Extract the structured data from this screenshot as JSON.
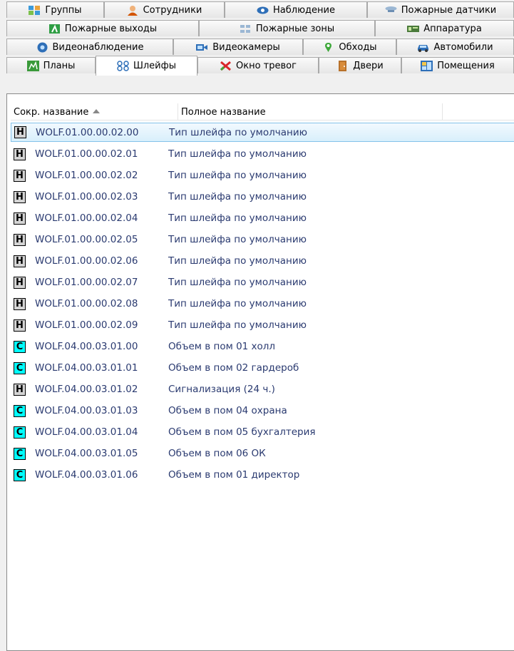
{
  "tabs": {
    "row1": [
      {
        "label": "Группы",
        "icon": "groups-icon"
      },
      {
        "label": "Сотрудники",
        "icon": "employee-icon"
      },
      {
        "label": "Наблюдение",
        "icon": "eye-icon"
      },
      {
        "label": "Пожарные датчики",
        "icon": "fire-sensor-icon"
      }
    ],
    "row2": [
      {
        "label": "Пожарные выходы",
        "icon": "fire-exit-icon"
      },
      {
        "label": "Пожарные зоны",
        "icon": "fire-zones-icon"
      },
      {
        "label": "Аппаратура",
        "icon": "hardware-icon"
      }
    ],
    "row3": [
      {
        "label": "Видеонаблюдение",
        "icon": "video-surveillance-icon"
      },
      {
        "label": "Видеокамеры",
        "icon": "video-camera-icon"
      },
      {
        "label": "Обходы",
        "icon": "patrol-icon"
      },
      {
        "label": "Автомобили",
        "icon": "car-icon"
      }
    ],
    "row4": [
      {
        "label": "Планы",
        "icon": "plans-icon"
      },
      {
        "label": "Шлейфы",
        "icon": "loops-icon",
        "active": true
      },
      {
        "label": "Окно тревог",
        "icon": "alarm-window-icon"
      },
      {
        "label": "Двери",
        "icon": "door-icon"
      },
      {
        "label": "Помещения",
        "icon": "rooms-icon"
      }
    ]
  },
  "list": {
    "columns": [
      "Сокр. название",
      "Полное название"
    ],
    "sorted_column": "Сокр. название",
    "rows": [
      {
        "badge": "H",
        "short": "WOLF.01.00.00.02.00",
        "full": "Тип шлейфа по умолчанию",
        "selected": true
      },
      {
        "badge": "H",
        "short": "WOLF.01.00.00.02.01",
        "full": "Тип шлейфа по умолчанию"
      },
      {
        "badge": "H",
        "short": "WOLF.01.00.00.02.02",
        "full": "Тип шлейфа по умолчанию"
      },
      {
        "badge": "H",
        "short": "WOLF.01.00.00.02.03",
        "full": "Тип шлейфа по умолчанию"
      },
      {
        "badge": "H",
        "short": "WOLF.01.00.00.02.04",
        "full": "Тип шлейфа по умолчанию"
      },
      {
        "badge": "H",
        "short": "WOLF.01.00.00.02.05",
        "full": "Тип шлейфа по умолчанию"
      },
      {
        "badge": "H",
        "short": "WOLF.01.00.00.02.06",
        "full": "Тип шлейфа по умолчанию"
      },
      {
        "badge": "H",
        "short": "WOLF.01.00.00.02.07",
        "full": "Тип шлейфа по умолчанию"
      },
      {
        "badge": "H",
        "short": "WOLF.01.00.00.02.08",
        "full": "Тип шлейфа по умолчанию"
      },
      {
        "badge": "H",
        "short": "WOLF.01.00.00.02.09",
        "full": "Тип шлейфа по умолчанию"
      },
      {
        "badge": "C",
        "short": "WOLF.04.00.03.01.00",
        "full": "Объем в пом 01 холл"
      },
      {
        "badge": "C",
        "short": "WOLF.04.00.03.01.01",
        "full": "Объем в пом 02 гардероб"
      },
      {
        "badge": "H",
        "short": "WOLF.04.00.03.01.02",
        "full": "Сигнализация (24 ч.)"
      },
      {
        "badge": "C",
        "short": "WOLF.04.00.03.01.03",
        "full": "Объем в пом 04 охрана"
      },
      {
        "badge": "C",
        "short": "WOLF.04.00.03.01.04",
        "full": "Объем в пом 05 бухгалтерия"
      },
      {
        "badge": "C",
        "short": "WOLF.04.00.03.01.05",
        "full": "Объем в пом 06 ОК"
      },
      {
        "badge": "C",
        "short": "WOLF.04.00.03.01.06",
        "full": "Объем в пом 01 директор"
      }
    ]
  },
  "colors": {
    "badge_H": "#d4d4d4",
    "badge_C": "#00ffff",
    "row_text": "#2a3a70",
    "selection": "#d8effc"
  }
}
